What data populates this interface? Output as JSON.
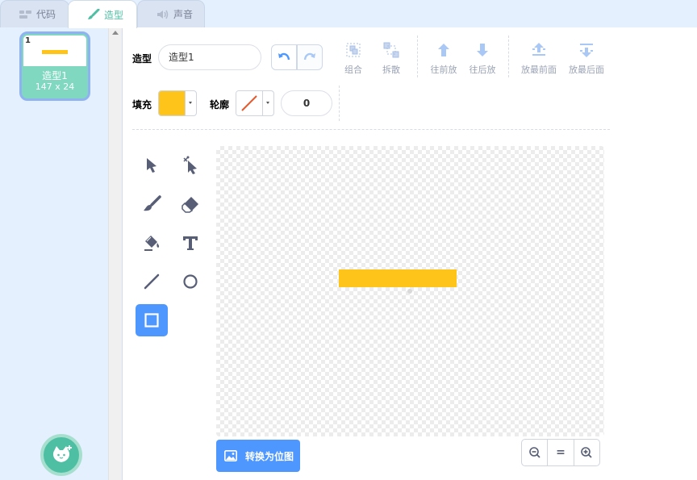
{
  "tabs": [
    {
      "label": "代码",
      "icon": "code-icon"
    },
    {
      "label": "造型",
      "icon": "brush-icon",
      "active": true
    },
    {
      "label": "声音",
      "icon": "speaker-icon"
    }
  ],
  "costumes": [
    {
      "number": "1",
      "name": "造型1",
      "size": "147 x 24",
      "selected": true
    }
  ],
  "editor": {
    "costume_label": "造型",
    "costume_name": "造型1",
    "actions": {
      "group": "组合",
      "ungroup": "拆散",
      "forward": "往前放",
      "backward": "往后放",
      "front": "放最前面",
      "back": "放最后面"
    },
    "fill_label": "填充",
    "fill_color": "#ffc41a",
    "outline_label": "轮廓",
    "outline_size": "0",
    "convert_button": "转换为位图",
    "zoom_reset": "="
  },
  "tools": [
    "select-tool",
    "reshape-tool",
    "brush-tool",
    "eraser-tool",
    "fill-tool",
    "text-tool",
    "line-tool",
    "circle-tool",
    "rectangle-tool"
  ],
  "selected_tool": "rectangle-tool",
  "colors": {
    "accent": "#4d97ff",
    "teal": "#4ebfa3",
    "fill": "#ffc41a"
  }
}
